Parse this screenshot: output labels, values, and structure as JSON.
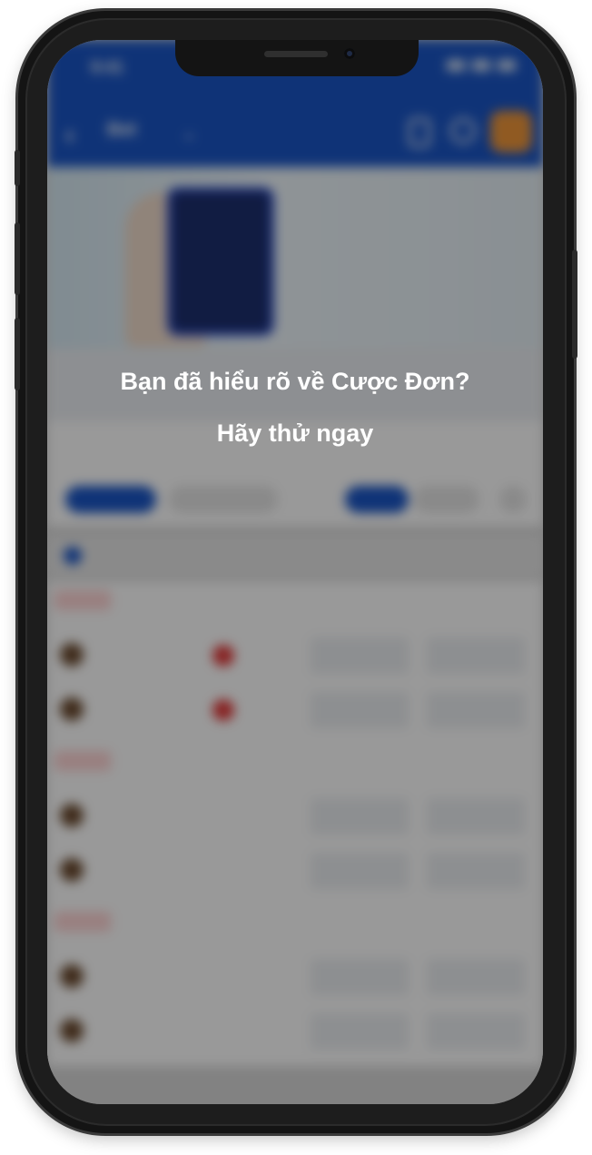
{
  "status_bar": {
    "time": "9:41"
  },
  "app_header": {
    "back_symbol": "‹",
    "title": "Bet",
    "chevron": "⌄"
  },
  "banner": {
    "headline": ""
  },
  "tabs": [
    {
      "label": ""
    },
    {
      "label": ""
    },
    {
      "label": ""
    },
    {
      "label": ""
    }
  ],
  "subtabs": [
    {
      "label": ""
    },
    {
      "label": ""
    },
    {
      "label": ""
    },
    {
      "label": ""
    },
    {
      "label": ""
    }
  ],
  "league": {
    "name": ""
  },
  "matches": [
    {
      "badge": "",
      "odds_headers": [
        "",
        ""
      ],
      "teams": [
        {
          "name": "",
          "score": "",
          "odd_1": "",
          "odd_2": ""
        },
        {
          "name": "",
          "score": "",
          "odd_1": "",
          "odd_2": ""
        }
      ]
    },
    {
      "badge": "",
      "odds_headers": [
        "",
        ""
      ],
      "teams": [
        {
          "name": "",
          "score": "",
          "odd_1": "",
          "odd_2": ""
        },
        {
          "name": "",
          "score": "",
          "odd_1": "",
          "odd_2": ""
        }
      ]
    },
    {
      "badge": "",
      "odds_headers": [
        "",
        ""
      ],
      "teams": [
        {
          "name": "",
          "score": "",
          "odd_1": "",
          "odd_2": ""
        },
        {
          "name": "",
          "score": "",
          "odd_1": "",
          "odd_2": ""
        }
      ]
    }
  ],
  "overlay": {
    "title": "Bạn đã hiểu rõ về Cược Đơn?",
    "subtitle": "Hãy thử ngay"
  },
  "colors": {
    "header_blue": "#1a56c7",
    "avatar_orange": "#f0973a",
    "odds_up": "#2fa83a",
    "odds_down": "#e23b3b"
  }
}
